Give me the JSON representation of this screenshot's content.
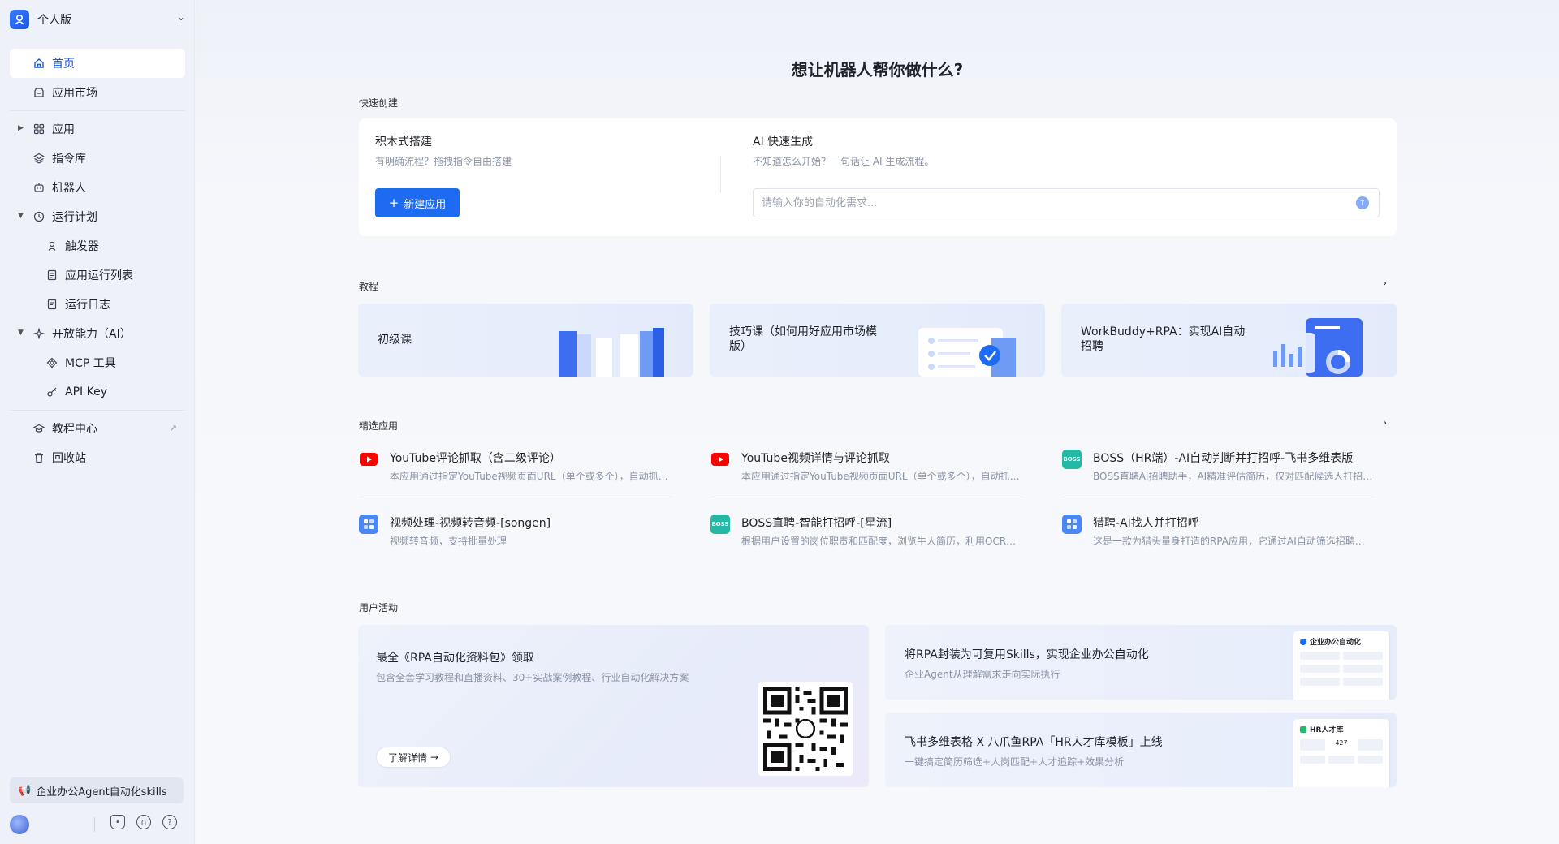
{
  "app": {
    "edition": "个人版"
  },
  "sidebar": {
    "items": [
      {
        "label": "首页",
        "icon": "home-icon"
      },
      {
        "label": "应用市场",
        "icon": "market-icon"
      },
      {
        "label": "应用",
        "icon": "apps-grid-icon"
      },
      {
        "label": "指令库",
        "icon": "layers-icon"
      },
      {
        "label": "机器人",
        "icon": "robot-icon"
      },
      {
        "label": "运行计划",
        "icon": "clock-icon"
      },
      {
        "label": "触发器",
        "icon": "trigger-icon"
      },
      {
        "label": "应用运行列表",
        "icon": "run-list-icon"
      },
      {
        "label": "运行日志",
        "icon": "log-icon"
      },
      {
        "label": "开放能力（AI）",
        "icon": "sparkle-icon"
      },
      {
        "label": "MCP 工具",
        "icon": "mcp-icon"
      },
      {
        "label": "API Key",
        "icon": "key-icon"
      },
      {
        "label": "教程中心",
        "icon": "graduation-cap-icon"
      },
      {
        "label": "回收站",
        "icon": "trash-icon"
      }
    ],
    "promo": "企业办公Agent自动化skills"
  },
  "main": {
    "hero_title": "想让机器人帮你做什么?",
    "quick_create": {
      "label": "快速创建",
      "block_title": "积木式搭建",
      "block_sub": "有明确流程？拖拽指令自由搭建",
      "new_app_button": "新建应用",
      "ai_title": "AI 快速生成",
      "ai_sub": "不知道怎么开始？一句话让 AI 生成流程。",
      "ai_placeholder": "请输入你的自动化需求..."
    },
    "tutorials": {
      "label": "教程",
      "cards": [
        {
          "title": "初级课"
        },
        {
          "title": "技巧课（如何用好应用市场模版）"
        },
        {
          "title": "WorkBuddy+RPA：实现AI自动招聘"
        }
      ]
    },
    "featured": {
      "label": "精选应用",
      "apps": [
        {
          "name": "YouTube评论抓取（含二级评论）",
          "desc": "本应用通过指定YouTube视频页面URL（单个或多个），自动抓取视频评论及二级评论",
          "icon": "youtube-icon"
        },
        {
          "name": "YouTube视频详情与评论抓取",
          "desc": "本应用通过指定YouTube视频页面URL（单个或多个），自动抓取视频详情与评论",
          "icon": "youtube-icon"
        },
        {
          "name": "BOSS（HR端）-AI自动判断并打招呼-飞书多维表版",
          "desc": "BOSS直聘AI招聘助手，AI精准评估简历，仅对匹配候选人打招呼并记录",
          "icon": "boss-icon"
        },
        {
          "name": "视频处理-视频转音频-[songen]",
          "desc": "视频转音频，支持批量处理",
          "icon": "app-grid-icon"
        },
        {
          "name": "BOSS直聘-智能打招呼-[星流]",
          "desc": "根据用户设置的岗位职责和匹配度，浏览牛人简历，利用OCR和AI智能打招呼",
          "icon": "boss-icon"
        },
        {
          "name": "猎聘-AI找人并打招呼",
          "desc": "这是一款为猎头量身打造的RPA应用，它通过AI自动筛选招聘平台候选人",
          "icon": "app-grid-icon"
        }
      ]
    },
    "activities": {
      "label": "用户活动",
      "big": {
        "title": "最全《RPA自动化资料包》领取",
        "sub": "包含全套学习教程和直播资料、30+实战案例教程、行业自动化解决方案",
        "button": "了解详情"
      },
      "small": [
        {
          "title": "将RPA封装为可复用Skills，实现企业办公自动化",
          "sub": "企业Agent从理解需求走向实际执行",
          "doc_title": "企业办公自动化"
        },
        {
          "title": "飞书多维表格 X 八爪鱼RPA「HR人才库模板」上线",
          "sub": "一键搞定简历筛选+人岗匹配+人才追踪+效果分析",
          "doc_title": "HR人才库",
          "doc_value": "427"
        }
      ]
    }
  },
  "colors": {
    "accent": "#1d6bf0",
    "sidebar_bg": "#eef1f8",
    "active_text": "#1657e8"
  }
}
